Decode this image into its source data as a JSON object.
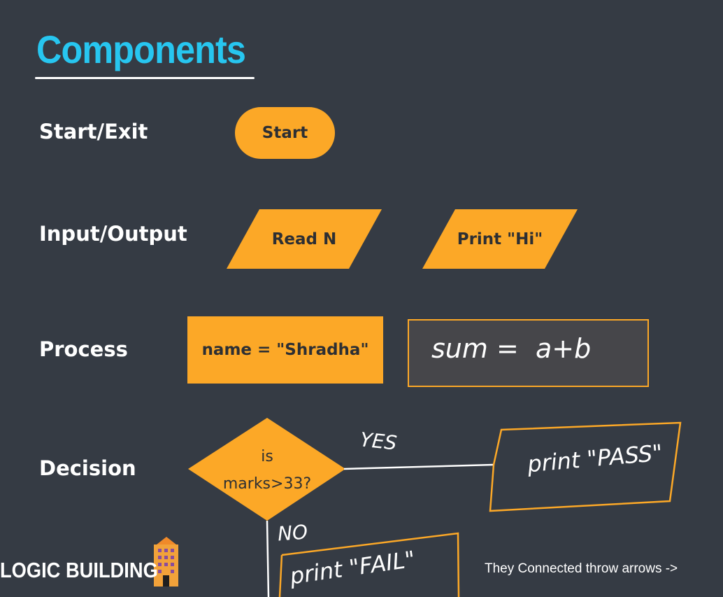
{
  "title": "Components",
  "rows": {
    "start": {
      "label": "Start/Exit",
      "shape_text": "Start"
    },
    "io": {
      "label": "Input/Output",
      "shape1_text": "Read N",
      "shape2_text": "Print \"Hi\""
    },
    "process": {
      "label": "Process",
      "shape_text": "name = \"Shradha\"",
      "handwritten": "sum =  a+b"
    },
    "decision": {
      "label": "Decision",
      "line1": "is",
      "line2": "marks>33?",
      "yes_label": "YES",
      "no_label": "NO",
      "yes_box": "print \"PASS\"",
      "no_box": "print \"FAIL\""
    }
  },
  "footer": {
    "brand": "LOGIC BUILDING",
    "note": "They Connected throw arrows ->"
  },
  "colors": {
    "accent": "#fca827",
    "title": "#27c6f0",
    "background": "#353b44"
  }
}
